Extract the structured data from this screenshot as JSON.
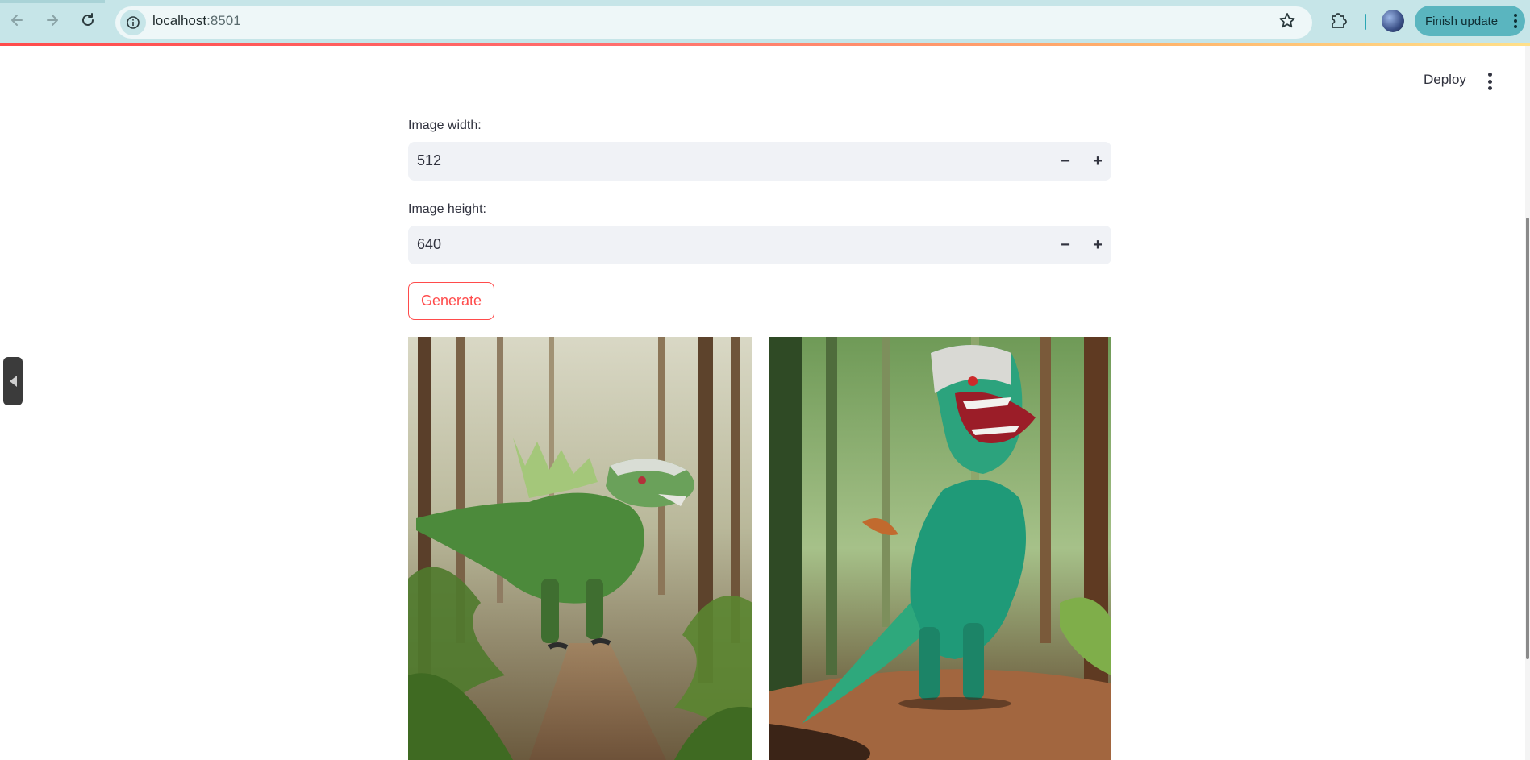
{
  "browser": {
    "url_host": "localhost",
    "url_port": ":8501",
    "finish_update_label": "Finish update"
  },
  "header": {
    "deploy_label": "Deploy"
  },
  "form": {
    "width_label": "Image width:",
    "width_value": "512",
    "height_label": "Image height:",
    "height_value": "640",
    "generate_label": "Generate"
  },
  "icons": {
    "back": "arrow-left-icon",
    "forward": "arrow-right-icon",
    "reload": "reload-icon",
    "site_info": "info-icon",
    "bookmark": "star-icon",
    "extensions": "puzzle-icon",
    "profile": "avatar",
    "menu": "more-vert-icon",
    "sidebar": "sidebar-collapse-icon"
  },
  "colors": {
    "accent": "#ff4b4b",
    "chrome": "#c6e5e8",
    "finish_update": "#5ab5bf"
  }
}
